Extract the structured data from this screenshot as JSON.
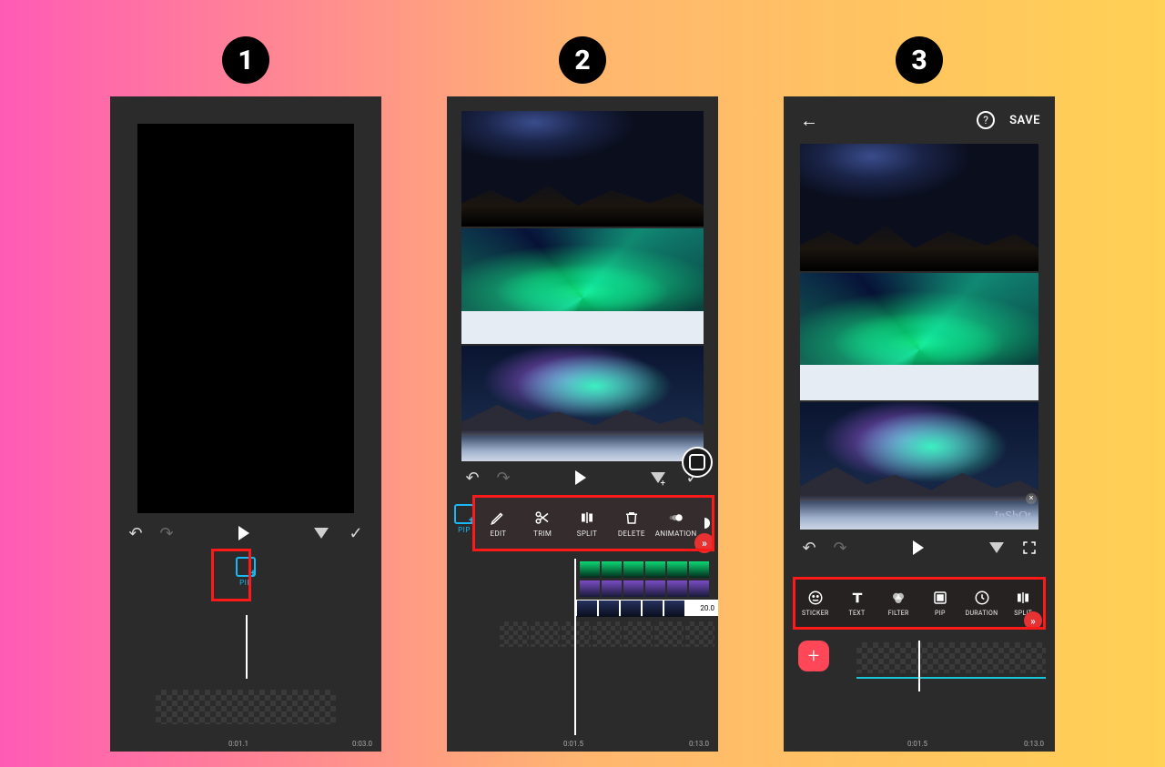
{
  "steps": {
    "one": "1",
    "two": "2",
    "three": "3"
  },
  "phone1": {
    "pip_label": "PIP",
    "time_current": "0:01.1",
    "time_total": "0:03.0"
  },
  "phone2": {
    "pip_label": "PIP",
    "toolbar": {
      "edit": "EDIT",
      "trim": "TRIM",
      "split": "SPLIT",
      "delete": "DELETE",
      "animation": "ANIMATION"
    },
    "duration_badge": "20.0",
    "time_current": "0:01.5",
    "time_total": "0:13.0"
  },
  "phone3": {
    "save": "SAVE",
    "watermark": "InShOt",
    "toolbar": {
      "sticker": "STICKER",
      "text": "TEXT",
      "filter": "FILTER",
      "pip": "PIP",
      "duration": "DURATION",
      "split": "SPLIT"
    },
    "time_current": "0:01.5",
    "time_total": "0:13.0"
  }
}
